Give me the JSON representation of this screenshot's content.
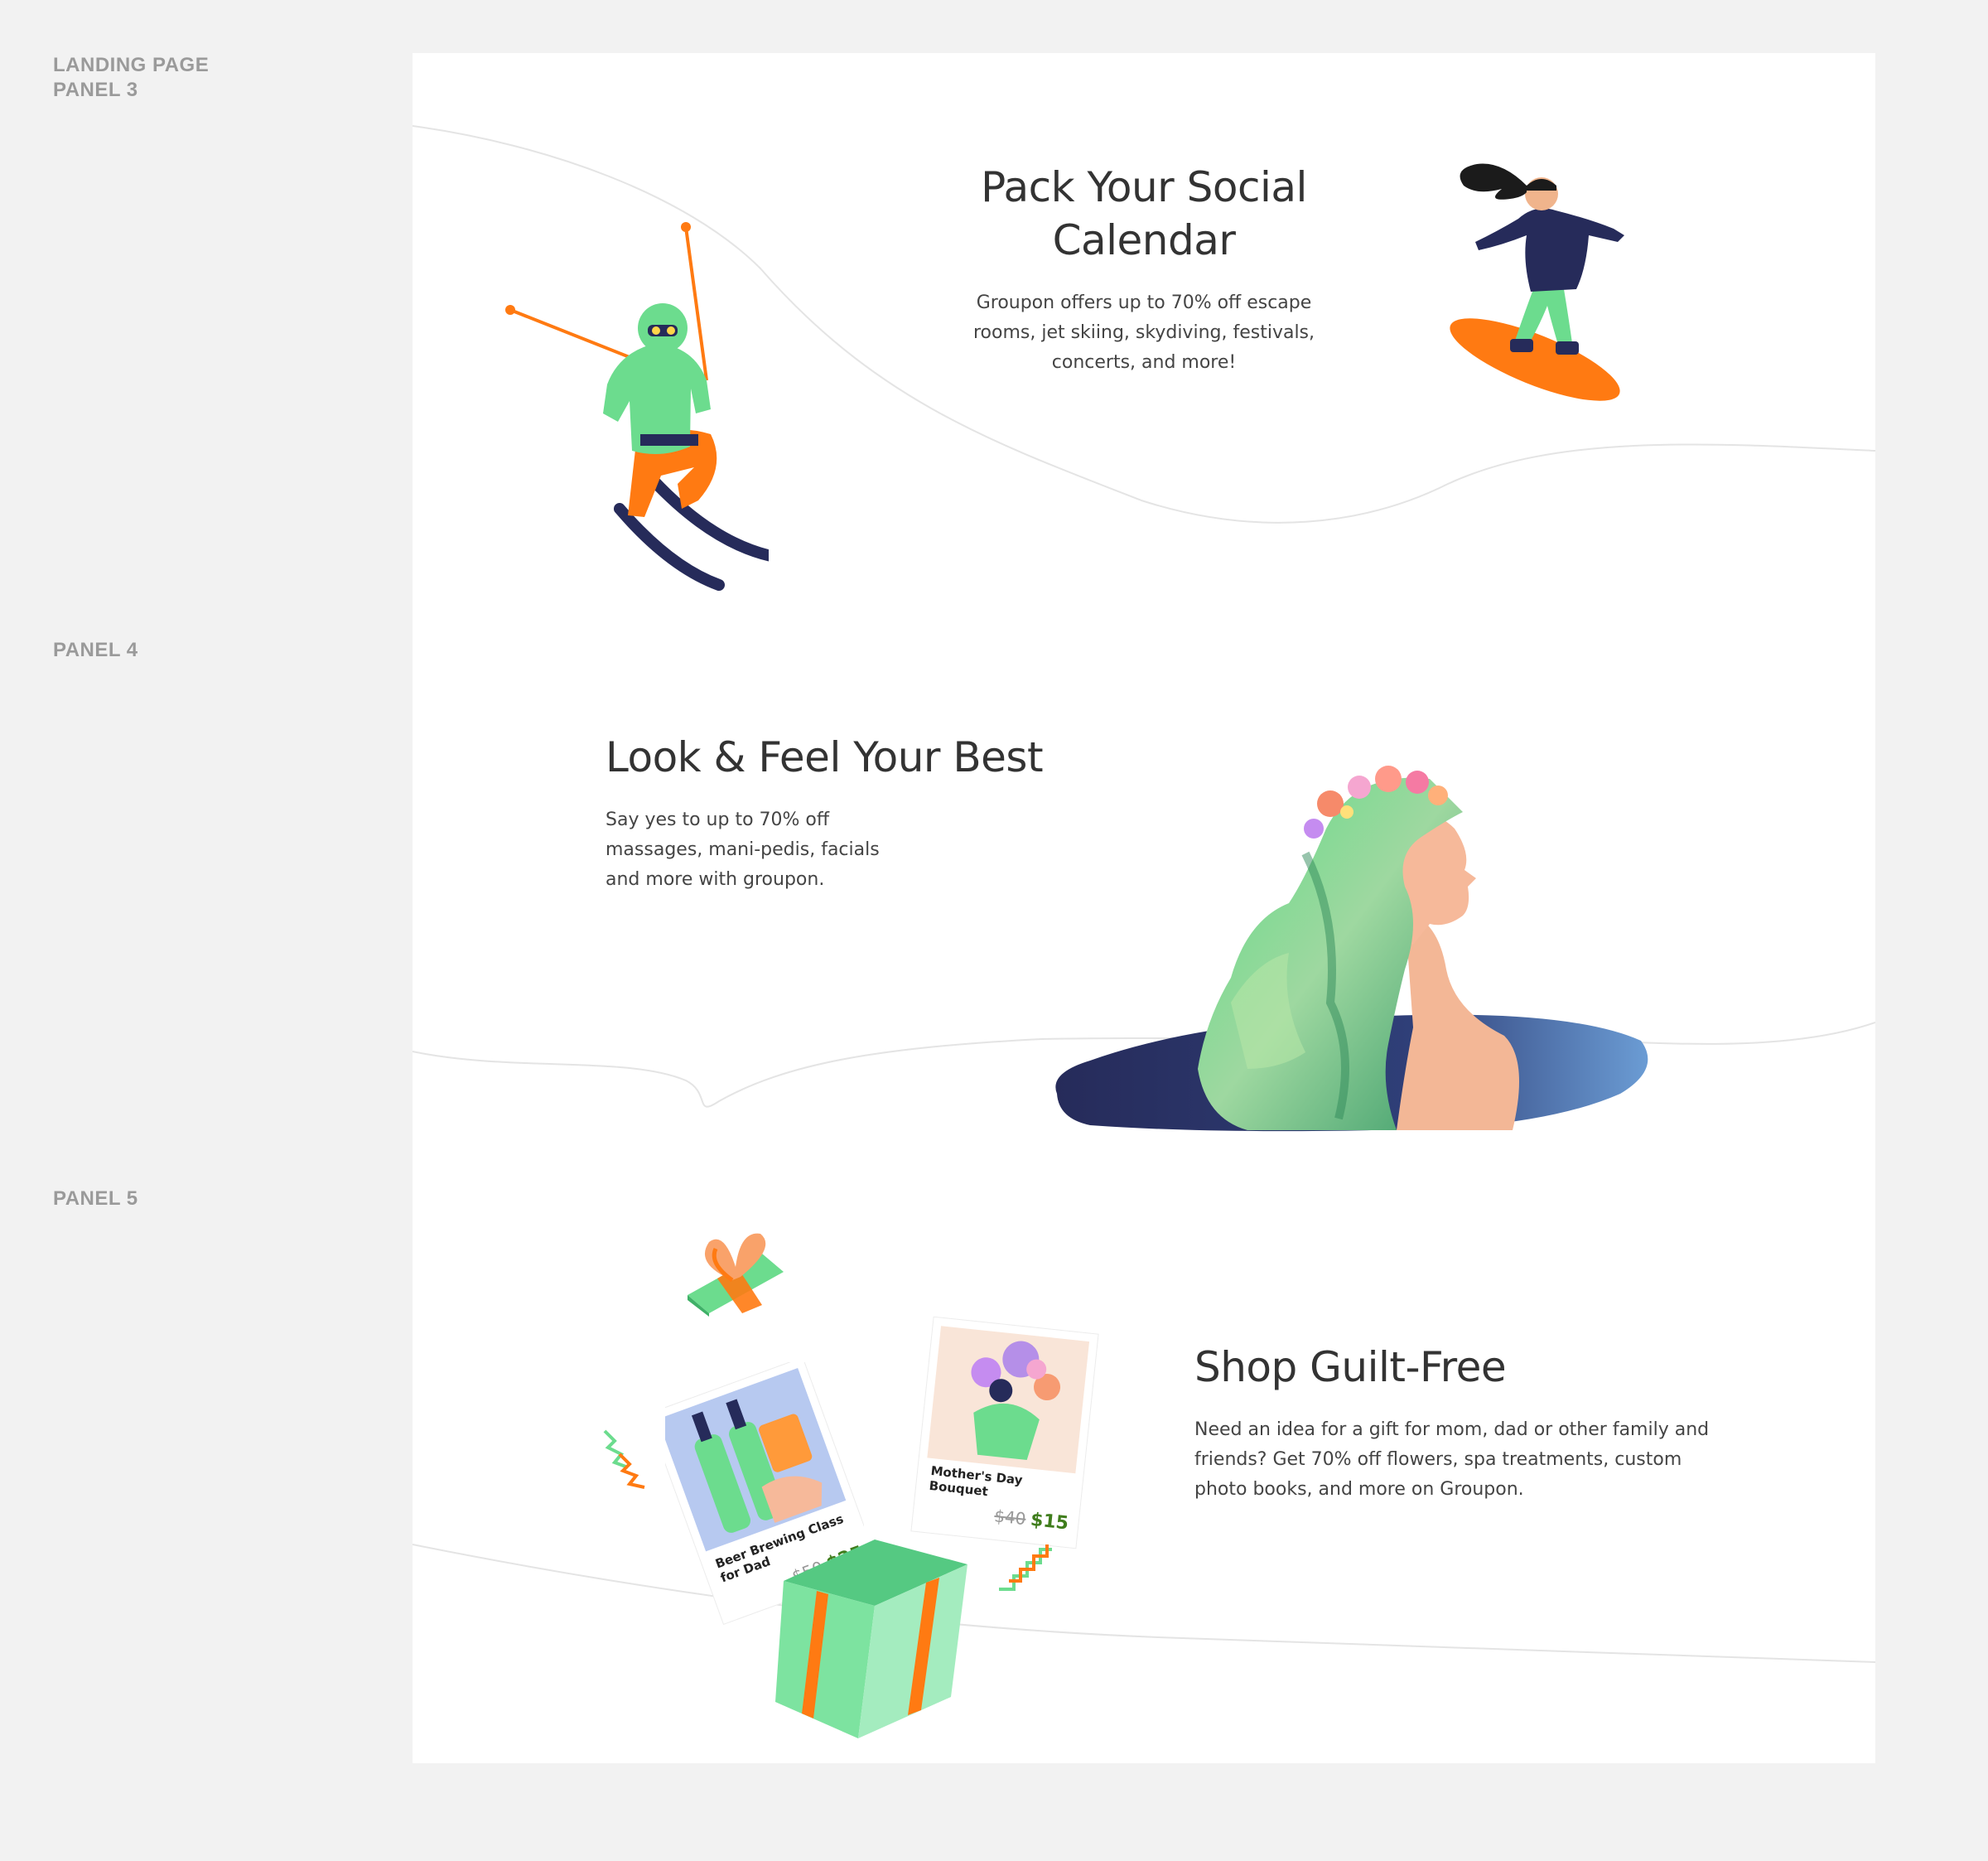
{
  "labels": {
    "landing_page": "LANDING PAGE",
    "panel3": "PANEL 3",
    "panel4": "PANEL 4",
    "panel5": "PANEL 5"
  },
  "panel3": {
    "title_line1": "Pack Your Social",
    "title_line2": "Calendar",
    "body_line1": "Groupon offers up to 70% off escape",
    "body_line2": "rooms, jet skiing, skydiving, festivals,",
    "body_line3": "concerts, and more!"
  },
  "panel4": {
    "title": "Look & Feel Your Best",
    "body_line1": "Say yes to up to 70% off",
    "body_line2": "massages, mani-pedis, facials",
    "body_line3": "and more with groupon."
  },
  "panel5": {
    "title": "Shop Guilt-Free",
    "body_line1": "Need an idea for a gift for mom, dad or other family and",
    "body_line2": "friends? Get 70% off flowers, spa treatments, custom",
    "body_line3": "photo books, and more on Groupon.",
    "card_beer": {
      "title_line1": "Beer Brewing Class",
      "title_line2": "for Dad",
      "old_price": "$50",
      "new_price": "$25"
    },
    "card_flowers": {
      "title_line1": "Mother's Day",
      "title_line2": "Bouquet",
      "old_price": "$40",
      "new_price": "$15"
    }
  },
  "colors": {
    "green": "#6cdc8e",
    "orange": "#ff7a12",
    "navy": "#262b5a",
    "price_green": "#3f7d1c"
  }
}
